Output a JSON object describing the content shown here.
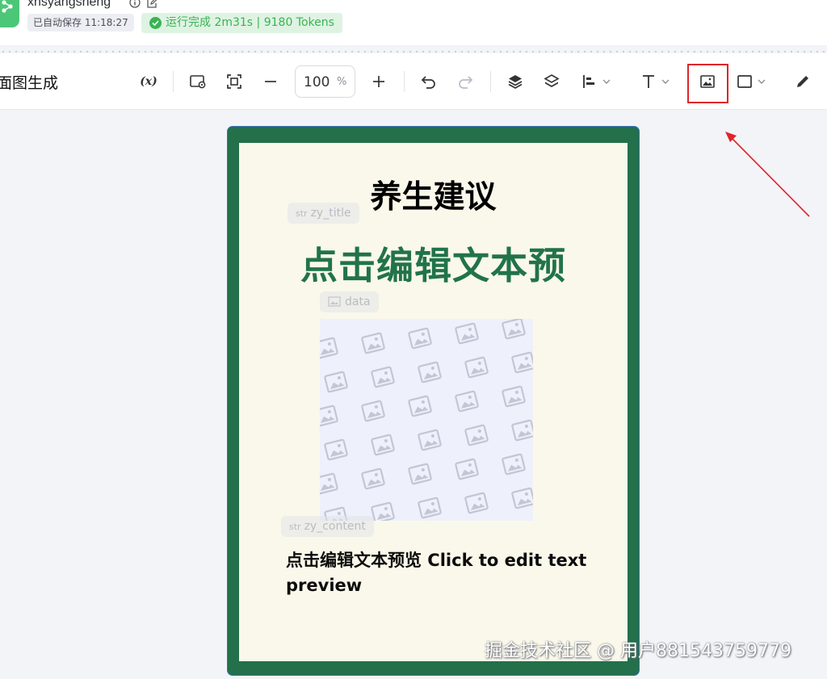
{
  "header": {
    "app_name": "xhsyangsheng",
    "autosave_text": "已自动保存 11:18:27",
    "run_status": "运行完成 2m31s | 9180 Tokens"
  },
  "toolbar": {
    "title": "面图生成",
    "variable_label": "(x)",
    "zoom_value": "100",
    "zoom_unit": "%",
    "highlighted_tool": "image-tool"
  },
  "canvas": {
    "title": "养生建议",
    "title_tag_prefix": "str",
    "title_tag": "zy_title",
    "big_text": "点击编辑文本预",
    "image_tag": "data",
    "content_tag_prefix": "str",
    "content_tag": "zy_content",
    "content_text": "点击编辑文本预览 Click to edit text preview"
  },
  "colors": {
    "card_border": "#23704a",
    "card_bg": "#faf8ea",
    "accent_green": "#21734a",
    "status_green": "#3bb354",
    "highlight_red": "#e0242b"
  },
  "watermark": "掘金技术社区 @ 用户881543759779"
}
